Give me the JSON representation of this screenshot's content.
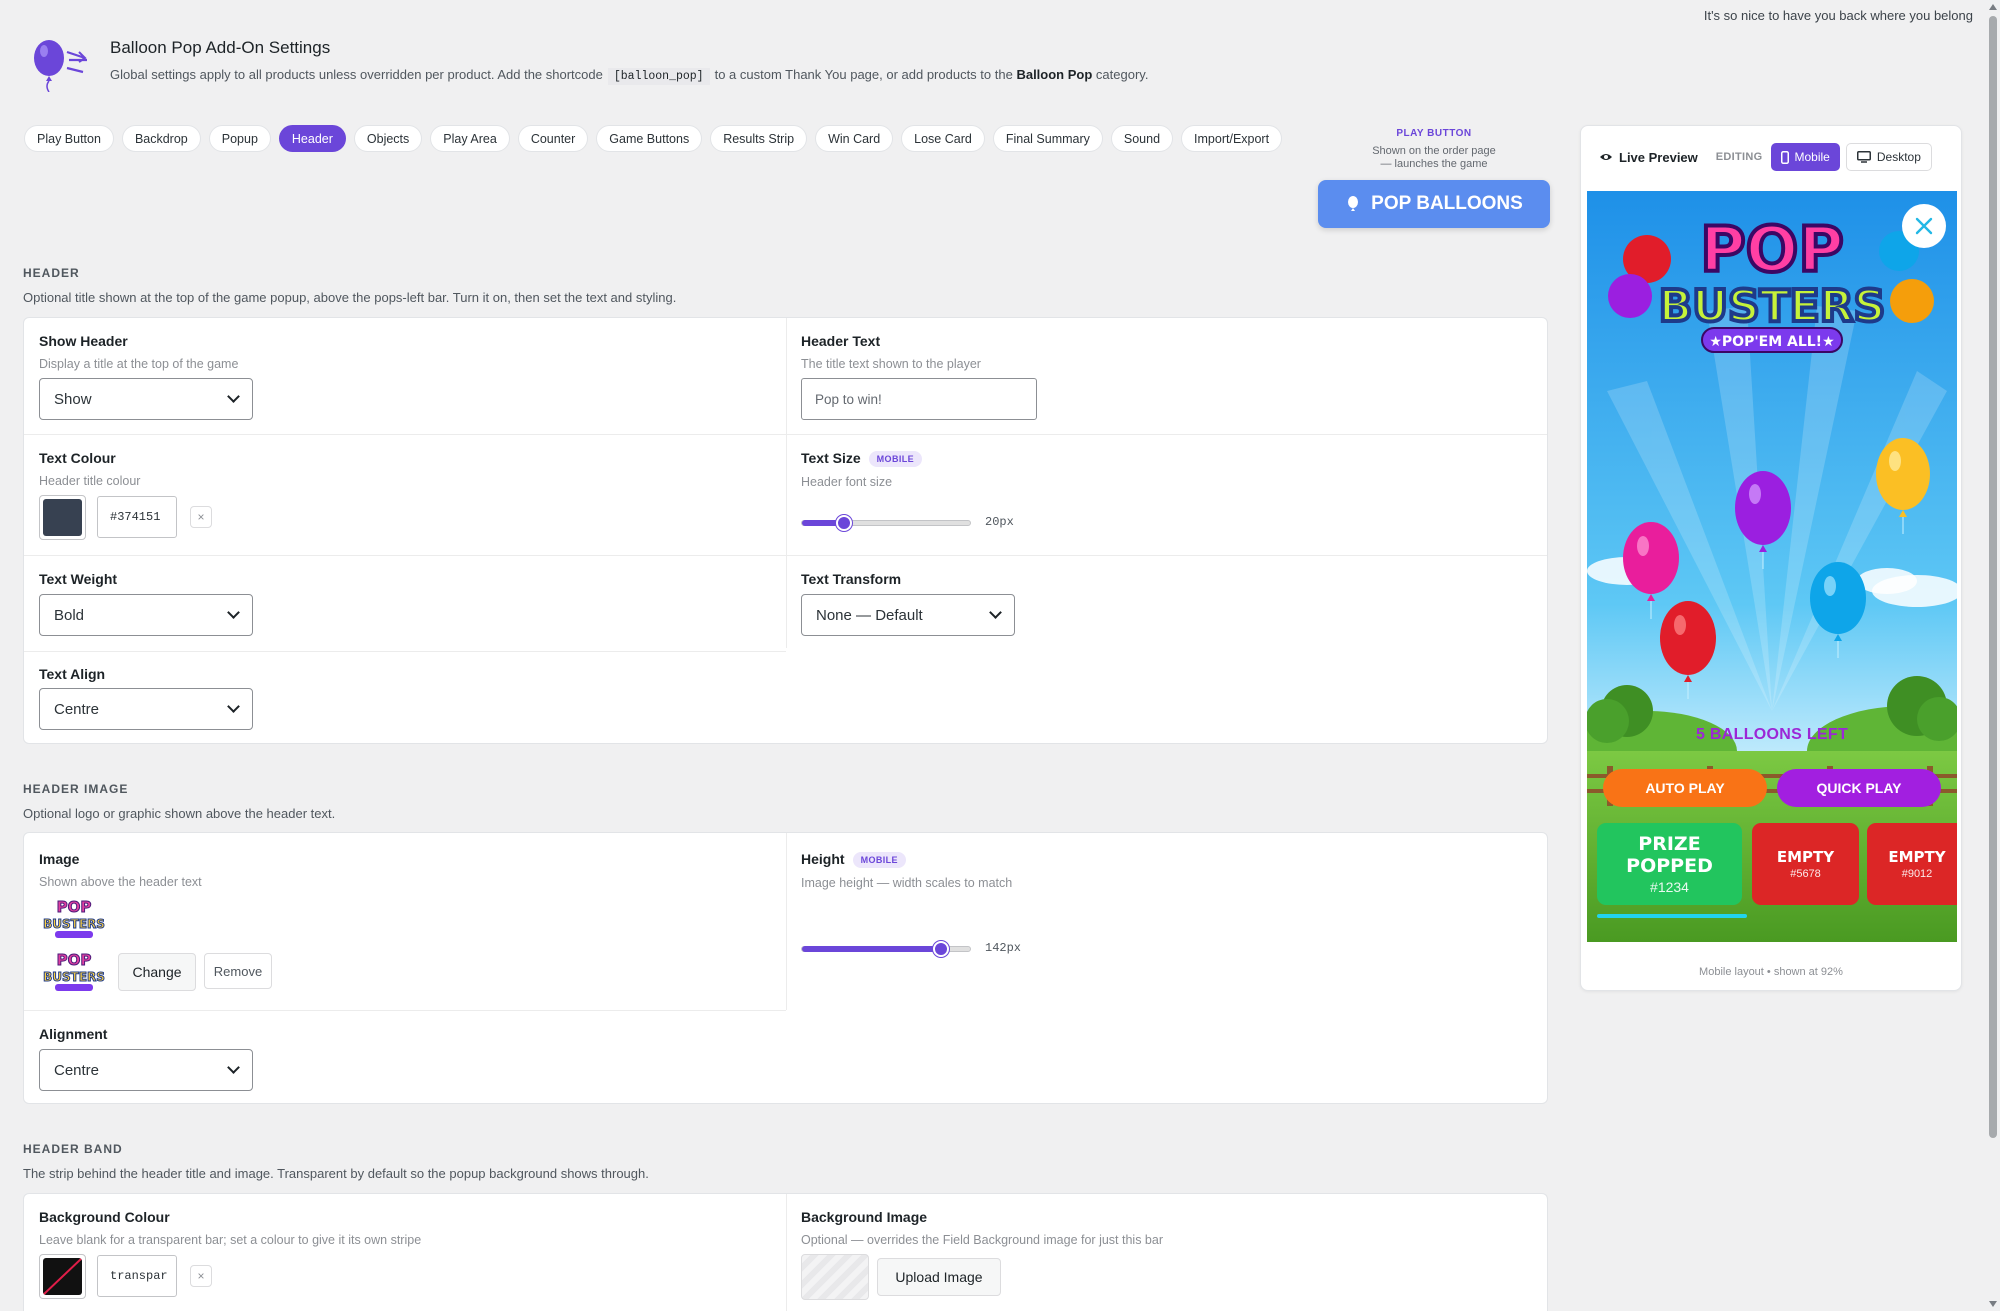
{
  "top_note": "It's so nice to have you back where you belong",
  "header": {
    "title": "Balloon Pop Add-On Settings",
    "desc_part1": "Global settings apply to all products unless overridden per product. Add the shortcode",
    "shortcode": "[balloon_pop]",
    "desc_part2": "to a custom Thank You page, or add products to the",
    "category_name": "Balloon Pop",
    "desc_part3": "category."
  },
  "tabs": [
    "Play Button",
    "Backdrop",
    "Popup",
    "Header",
    "Objects",
    "Play Area",
    "Counter",
    "Game Buttons",
    "Results Strip",
    "Win Card",
    "Lose Card",
    "Final Summary",
    "Sound",
    "Import/Export"
  ],
  "active_tab": "Header",
  "play_button": {
    "label": "PLAY BUTTON",
    "help_line1": "Shown on the order page",
    "help_line2": "— launches the game",
    "button_text": "POP BALLOONS"
  },
  "section_header": {
    "title": "HEADER",
    "desc": "Optional title shown at the top of the game popup, above the pops-left bar. Turn it on, then set the text and styling.",
    "show_header": {
      "label": "Show Header",
      "help": "Display a title at the top of the game",
      "value": "Show"
    },
    "header_text": {
      "label": "Header Text",
      "help": "The title text shown to the player",
      "placeholder": "Pop to win!"
    },
    "text_colour": {
      "label": "Text Colour",
      "help": "Header title colour",
      "value": "#374151",
      "clear": "×"
    },
    "text_size": {
      "label": "Text Size",
      "badge": "MOBILE",
      "help": "Header font size",
      "value": "20px",
      "fraction": 0.25
    },
    "text_weight": {
      "label": "Text Weight",
      "value": "Bold"
    },
    "text_transform": {
      "label": "Text Transform",
      "value": "None — Default"
    },
    "text_align": {
      "label": "Text Align",
      "value": "Centre"
    }
  },
  "section_image": {
    "title": "HEADER IMAGE",
    "desc": "Optional logo or graphic shown above the header text.",
    "image": {
      "label": "Image",
      "help": "Shown above the header text",
      "change": "Change",
      "remove": "Remove"
    },
    "height": {
      "label": "Height",
      "badge": "MOBILE",
      "help": "Image height — width scales to match",
      "value": "142px",
      "fraction": 0.83
    },
    "alignment": {
      "label": "Alignment",
      "value": "Centre"
    }
  },
  "section_band": {
    "title": "HEADER BAND",
    "desc": "The strip behind the header title and image. Transparent by default so the popup background shows through.",
    "bg_colour": {
      "label": "Background Colour",
      "help": "Leave blank for a transparent bar; set a colour to give it its own stripe",
      "value": "transpar",
      "clear": "×"
    },
    "bg_image": {
      "label": "Background Image",
      "help": "Optional — overrides the Field Background image for just this bar",
      "upload": "Upload Image"
    }
  },
  "preview": {
    "title": "Live Preview",
    "editing": "EDITING",
    "mobile": "Mobile",
    "desktop": "Desktop",
    "footer": "Mobile layout • shown at 92%",
    "game": {
      "logo_line1": "POP",
      "logo_line2": "BUSTERS",
      "logo_ribbon": "★POP'EM ALL!★",
      "balloons_left": "5 BALLOONS LEFT",
      "auto_play": "AUTO PLAY",
      "quick_play": "QUICK PLAY",
      "results": [
        {
          "title_1": "PRIZE",
          "title_2": "POPPED",
          "code": "#1234",
          "color": "#22c55e"
        },
        {
          "title_1": "EMPTY",
          "title_2": "",
          "code": "#5678",
          "color": "#dc2626"
        },
        {
          "title_1": "EMPTY",
          "title_2": "",
          "code": "#9012",
          "color": "#dc2626"
        }
      ]
    }
  },
  "colors": {
    "accent": "#6b46d9",
    "play_button": "#5b8def",
    "text_colour_swatch": "#374151"
  }
}
